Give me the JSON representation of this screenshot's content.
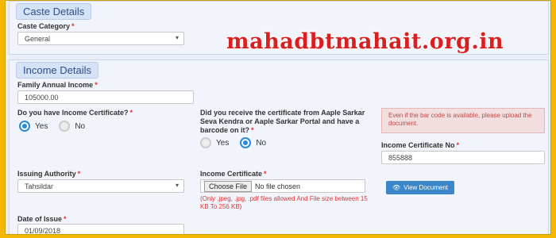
{
  "caste": {
    "section_title": "Caste Details",
    "category_label": "Caste Category",
    "category_value": "General"
  },
  "income": {
    "section_title": "Income Details",
    "family_income_label": "Family Annual Income",
    "family_income_value": "105000.00",
    "has_certificate_label": "Do you have Income Certificate?",
    "has_certificate_options": [
      "Yes",
      "No"
    ],
    "has_certificate_selected": "Yes",
    "barcode_question": "Did you receive the certificate from Aaple Sarkar Seva Kendra or Aaple Sarkar Portal and have a barcode on it?",
    "barcode_options": [
      "Yes",
      "No"
    ],
    "barcode_selected": "No",
    "alert_text": "Even if the bar code is available, please upload the document.",
    "cert_no_label": "Income Certificate No",
    "cert_no_value": "855888",
    "issuing_label": "Issuing Authority",
    "issuing_value": "Tahsildar",
    "cert_file_label": "Income Certificate",
    "choose_file_label": "Choose File",
    "no_file_text": "No file chosen",
    "file_hint": "(Only .jpeg, .jpg, .pdf files allowed And File size between 15 KB To 256 KB)",
    "view_doc_label": "View Document",
    "date_label": "Date of Issue",
    "date_value": "01/09/2018"
  },
  "watermark": "mahadbtmahait.org.in",
  "required_mark": "*",
  "colors": {
    "outer_border": "#f5b800",
    "accent": "#2a89d8",
    "alert_bg": "#f2dede",
    "alert_text": "#b94a48",
    "watermark": "#d91f1f"
  },
  "icons": {
    "dropdown": "chevron-down-icon",
    "view": "eye-icon"
  }
}
